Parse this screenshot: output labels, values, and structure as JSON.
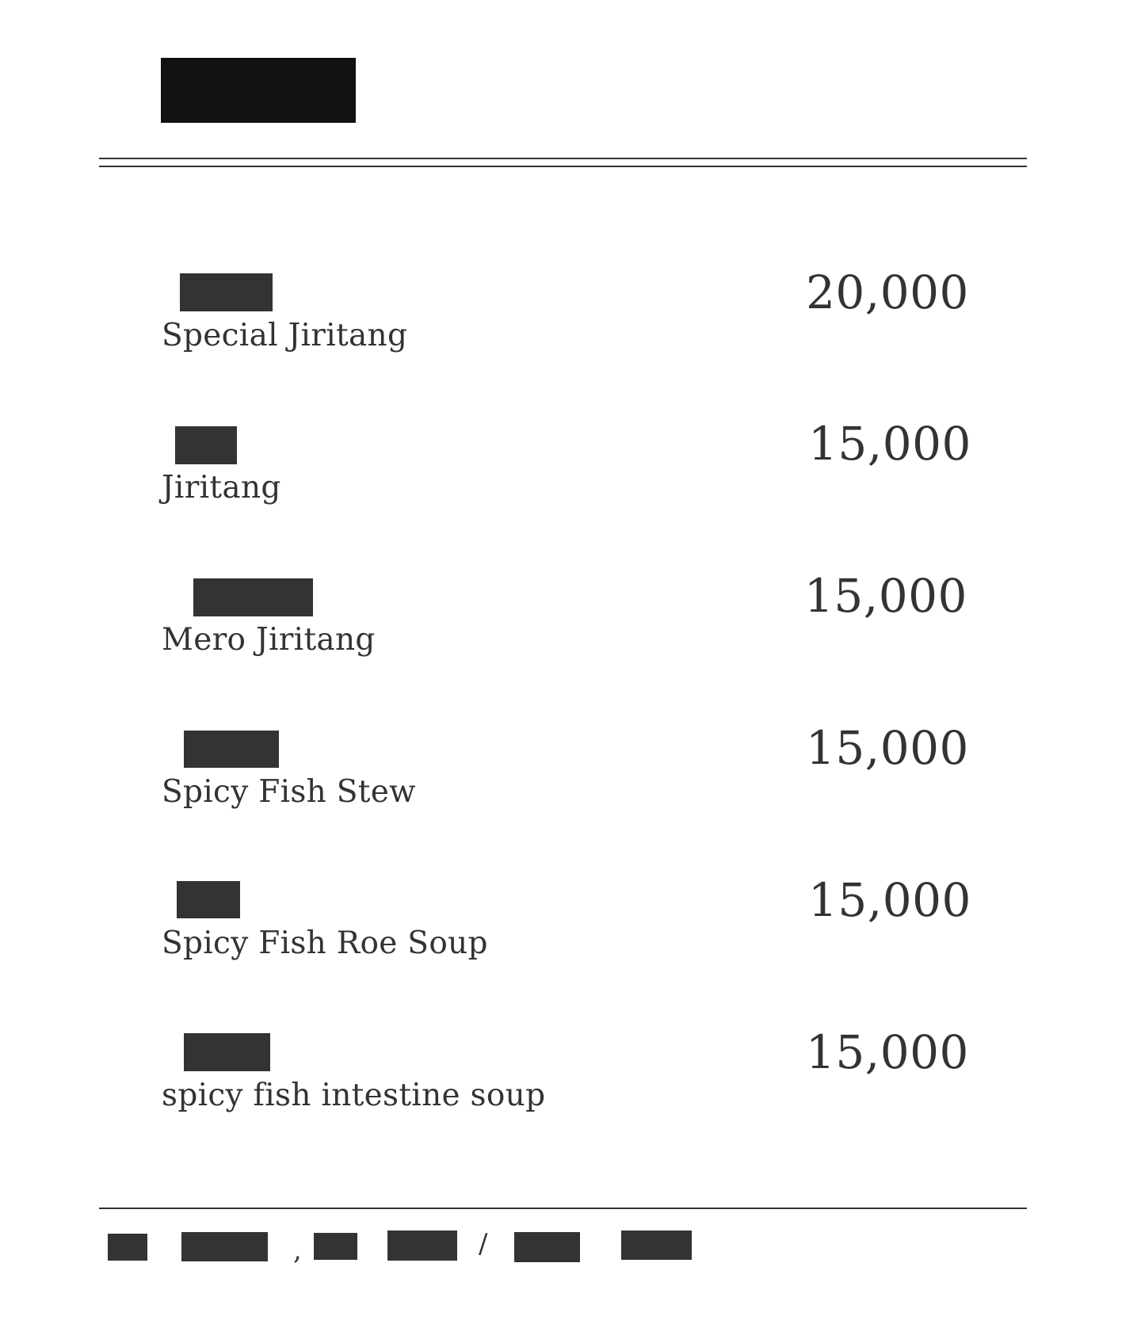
{
  "menu": {
    "items": [
      {
        "name": "Special Jiritang",
        "price": "20,000"
      },
      {
        "name": "Jiritang",
        "price": "15,000"
      },
      {
        "name": "Mero Jiritang",
        "price": "15,000"
      },
      {
        "name": "Spicy Fish Stew",
        "price": "15,000"
      },
      {
        "name": "Spicy Fish Roe Soup",
        "price": "15,000"
      },
      {
        "name": "spicy fish intestine soup",
        "price": "15,000"
      }
    ]
  },
  "footer": {
    "comma": ",",
    "slash": "/"
  }
}
